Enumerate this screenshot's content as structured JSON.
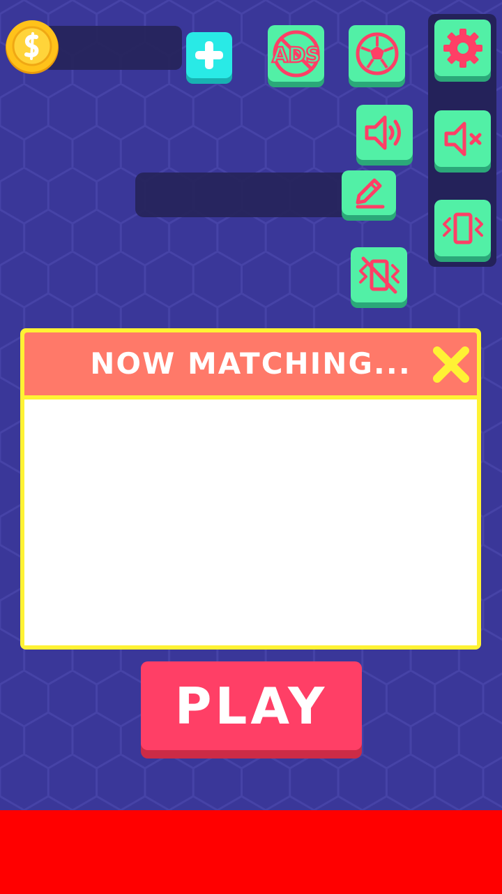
{
  "colors": {
    "background": "#3a3799",
    "tile_green": "#52f0a6",
    "tile_cyan": "#29eae6",
    "icon_pink": "#ff3f66",
    "popup_border": "#fff234",
    "popup_header": "#ff7969",
    "play_button": "#ff3f66",
    "ad_banner": "#ff0000",
    "coin_gold": "#ffc21a"
  },
  "topbar": {
    "coin_icon": "coin-icon",
    "add_coins_icon": "plus-icon",
    "no_ads_icon": "no-ads-icon",
    "no_ads_text": "ADS",
    "ball_icon": "soccer-ball-icon"
  },
  "settings": {
    "icons": [
      "gear-icon",
      "mute-icon",
      "vibration-icon"
    ]
  },
  "floating_buttons": {
    "sound_icon": "sound-on-icon",
    "edit_icon": "pencil-icon",
    "vibration_off_icon": "vibration-off-icon"
  },
  "popup": {
    "title": "NOW MATCHING...",
    "close_icon": "close-x-icon"
  },
  "play_button": {
    "label": "PLAY"
  }
}
